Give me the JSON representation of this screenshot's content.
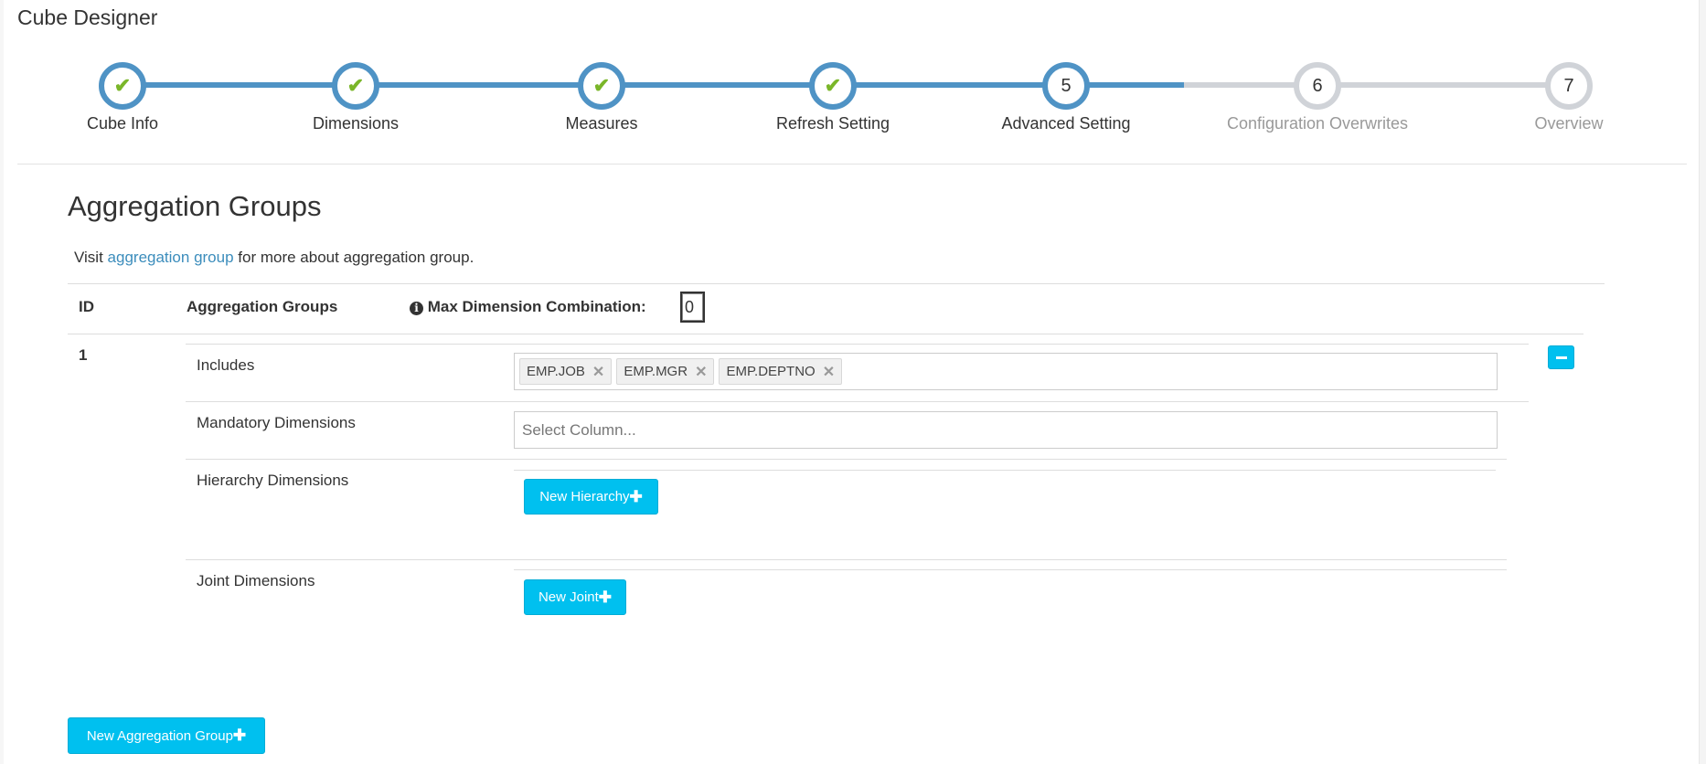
{
  "title": "Cube Designer",
  "steps": [
    {
      "label": "Cube Info",
      "num": "1",
      "status": "done"
    },
    {
      "label": "Dimensions",
      "num": "2",
      "status": "done"
    },
    {
      "label": "Measures",
      "num": "3",
      "status": "done"
    },
    {
      "label": "Refresh Setting",
      "num": "4",
      "status": "done"
    },
    {
      "label": "Advanced Setting",
      "num": "5",
      "status": "current"
    },
    {
      "label": "Configuration Overwrites",
      "num": "6",
      "status": "todo"
    },
    {
      "label": "Overview",
      "num": "7",
      "status": "todo"
    }
  ],
  "colors": {
    "active": "#4f93c5",
    "inactive": "#d0d3d8",
    "check": "#7ab629",
    "button": "#00c0ef",
    "link": "#3c8dbc"
  },
  "section": {
    "title": "Aggregation Groups",
    "visit_prefix": "Visit ",
    "visit_link": "aggregation group",
    "visit_suffix": " for more about aggregation group."
  },
  "table": {
    "col_id": "ID",
    "col_groups": "Aggregation Groups",
    "max_label": "Max Dimension Combination:",
    "max_value": "0"
  },
  "group": {
    "id": "1",
    "includes_label": "Includes",
    "includes": [
      "EMP.JOB",
      "EMP.MGR",
      "EMP.DEPTNO"
    ],
    "mandatory_label": "Mandatory Dimensions",
    "mandatory_placeholder": "Select Column...",
    "hierarchy_label": "Hierarchy Dimensions",
    "new_hierarchy": "New Hierarchy",
    "joint_label": "Joint Dimensions",
    "new_joint": "New Joint"
  },
  "new_group": "New Aggregation Group"
}
